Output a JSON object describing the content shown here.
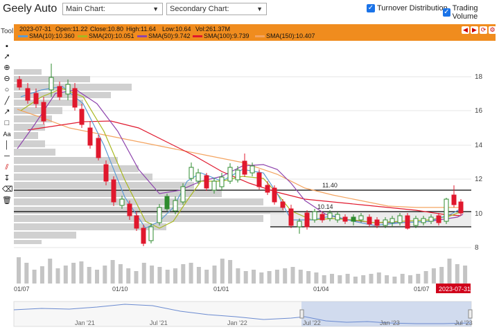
{
  "header": {
    "title": "Geely Auto",
    "main_chart": "Main Chart:",
    "secondary_chart": "Secondary Chart:",
    "turnover_distribution": "Turnover Distribution",
    "trading_volume": "Trading Volume"
  },
  "toolbar": {
    "tool_label": "Tool"
  },
  "ohlc": {
    "date": "2023-07-31",
    "open": "Open:11.22",
    "close": "Close:10.80",
    "high": "High:11.64",
    "low": "Low:10.64",
    "vol": "Vol:261.37M"
  },
  "sma": [
    {
      "label": "SMA(10):10.360",
      "color": "#5b9bd5"
    },
    {
      "label": "SMA(20):10.051",
      "color": "#a8b820"
    },
    {
      "label": "SMA(50):9.742",
      "color": "#8e44ad"
    },
    {
      "label": "SMA(100):9.739",
      "color": "#e0182d"
    },
    {
      "label": "SMA(150):10.407",
      "color": "#f4a460"
    }
  ],
  "price_axis": [
    "18",
    "16",
    "14",
    "12",
    "10",
    "8"
  ],
  "time_axis": [
    "01/07",
    "01/10",
    "01/01",
    "01/04",
    "01/07"
  ],
  "current_date_badge": "2023-07-31",
  "levels": {
    "upper": "11.40",
    "lower": "10.14"
  },
  "navigator_axis": [
    "Jan '21",
    "Jul '21",
    "Jan '22",
    "Jul '22",
    "Jan '23",
    "Jul '23"
  ],
  "colors": {
    "accent": "#f08c1e",
    "bear": "#e0182d",
    "bull": "#2e8b2e"
  },
  "icons": [
    "pointer-icon",
    "zoom-in-icon",
    "zoom-out-icon",
    "circle-icon",
    "line-icon",
    "arrow-icon",
    "rectangle-icon",
    "text-icon",
    "vertical-line-icon",
    "horizontal-line-icon",
    "fibonacci-icon",
    "down-arrow-icon",
    "eraser-icon",
    "trash-icon"
  ]
}
